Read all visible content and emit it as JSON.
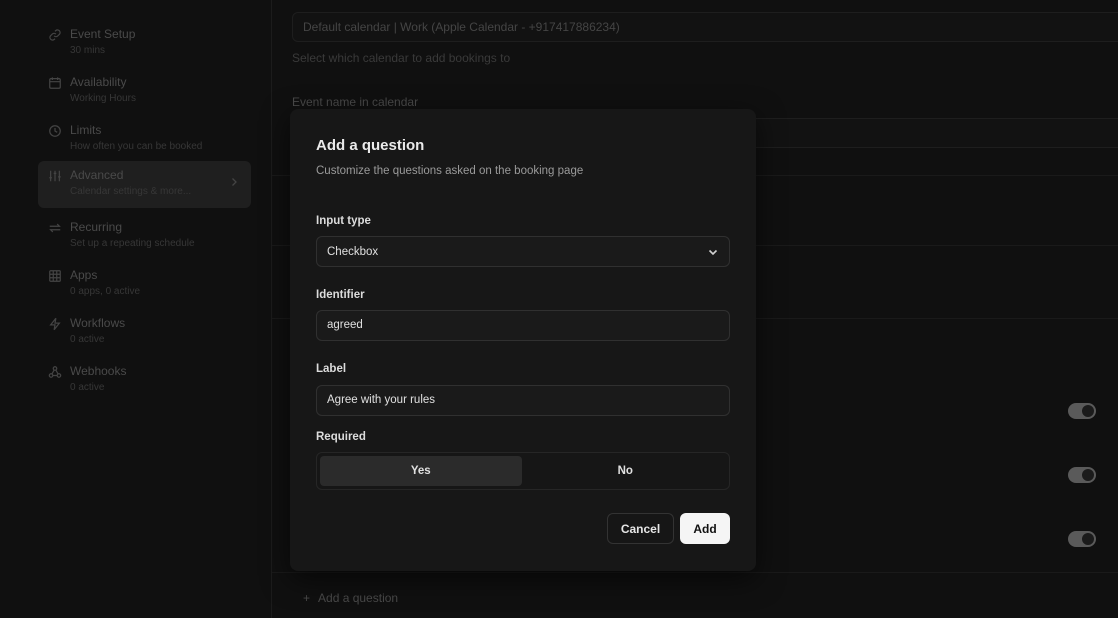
{
  "sidebar": {
    "items": [
      {
        "title": "Event Setup",
        "sub": "30 mins",
        "icon": "link-icon"
      },
      {
        "title": "Availability",
        "sub": "Working Hours",
        "icon": "calendar-icon"
      },
      {
        "title": "Limits",
        "sub": "How often you can be booked",
        "icon": "clock-icon"
      },
      {
        "title": "Advanced",
        "sub": "Calendar settings & more...",
        "icon": "sliders-icon"
      },
      {
        "title": "Recurring",
        "sub": "Set up a repeating schedule",
        "icon": "repeat-icon"
      },
      {
        "title": "Apps",
        "sub": "0 apps, 0 active",
        "icon": "grid-icon"
      },
      {
        "title": "Workflows",
        "sub": "0 active",
        "icon": "zap-icon"
      },
      {
        "title": "Webhooks",
        "sub": "0 active",
        "icon": "webhook-icon"
      }
    ]
  },
  "main": {
    "calendar_value": "Default calendar | Work (Apple Calendar - +917417886234)",
    "calendar_help": "Select which calendar to add bookings to",
    "event_name_label": "Event name in calendar",
    "add_question": "Add a question"
  },
  "modal": {
    "title": "Add a question",
    "subtitle": "Customize the questions asked on the booking page",
    "input_type_label": "Input type",
    "input_type_value": "Checkbox",
    "identifier_label": "Identifier",
    "identifier_value": "agreed",
    "label_label": "Label",
    "label_value": "Agree with your rules",
    "required_label": "Required",
    "required_yes": "Yes",
    "required_no": "No",
    "cancel_label": "Cancel",
    "add_label": "Add"
  }
}
